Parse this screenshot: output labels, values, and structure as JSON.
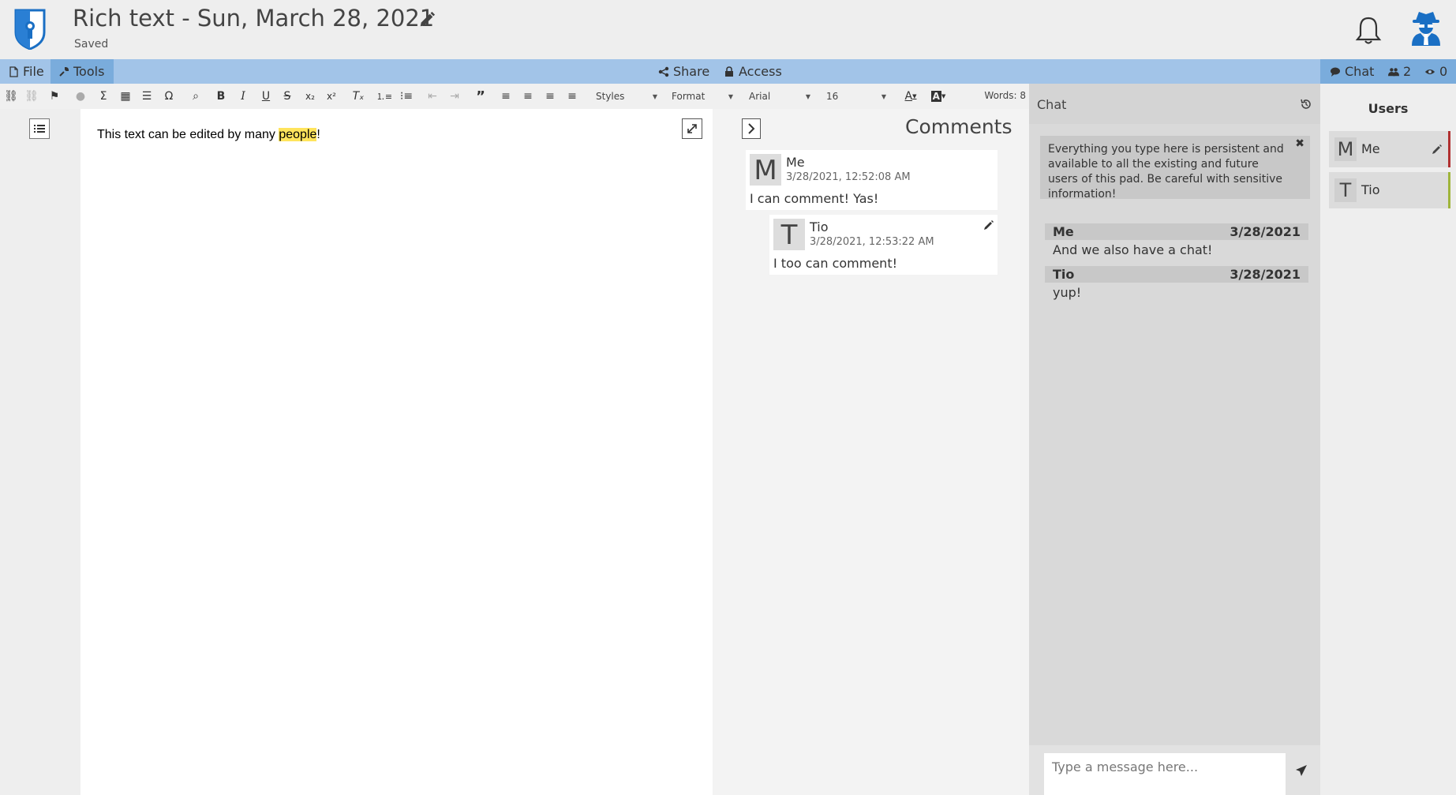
{
  "header": {
    "title": "Rich text - Sun, March 28, 2021",
    "status": "Saved"
  },
  "menubar": {
    "file": "File",
    "tools": "Tools",
    "share": "Share",
    "access": "Access",
    "chat": "Chat",
    "users_count": "2",
    "viewers_count": "0"
  },
  "toolbar": {
    "styles": "Styles",
    "format": "Format",
    "font": "Arial",
    "size": "16",
    "words": "Words: 8"
  },
  "editor": {
    "text_before": "This text can be edited by many ",
    "text_highlight": "people",
    "text_after": "!"
  },
  "comments": {
    "title": "Comments",
    "items": [
      {
        "avatar": "M",
        "author": "Me",
        "time": "3/28/2021, 12:52:08 AM",
        "body": "I can comment! Yas!"
      },
      {
        "avatar": "T",
        "author": "Tio",
        "time": "3/28/2021, 12:53:22 AM",
        "body": "I too can comment!"
      }
    ]
  },
  "chat": {
    "title": "Chat",
    "notice": "Everything you type here is persistent and available to all the existing and future users of this pad. Be careful with sensitive information!",
    "messages": [
      {
        "author": "Me",
        "date": "3/28/2021",
        "text": "And we also have a chat!"
      },
      {
        "author": "Tio",
        "date": "3/28/2021",
        "text": "yup!"
      }
    ],
    "placeholder": "Type a message here..."
  },
  "users": {
    "title": "Users",
    "list": [
      {
        "avatar": "M",
        "name": "Me",
        "color": "#b03030"
      },
      {
        "avatar": "T",
        "name": "Tio",
        "color": "#9fb53b"
      }
    ]
  },
  "colors": {
    "brand": "#1a6fc4",
    "menubar": "#a2c4e8",
    "menubar_active": "#7aacdc",
    "highlight": "#ffe45c"
  }
}
